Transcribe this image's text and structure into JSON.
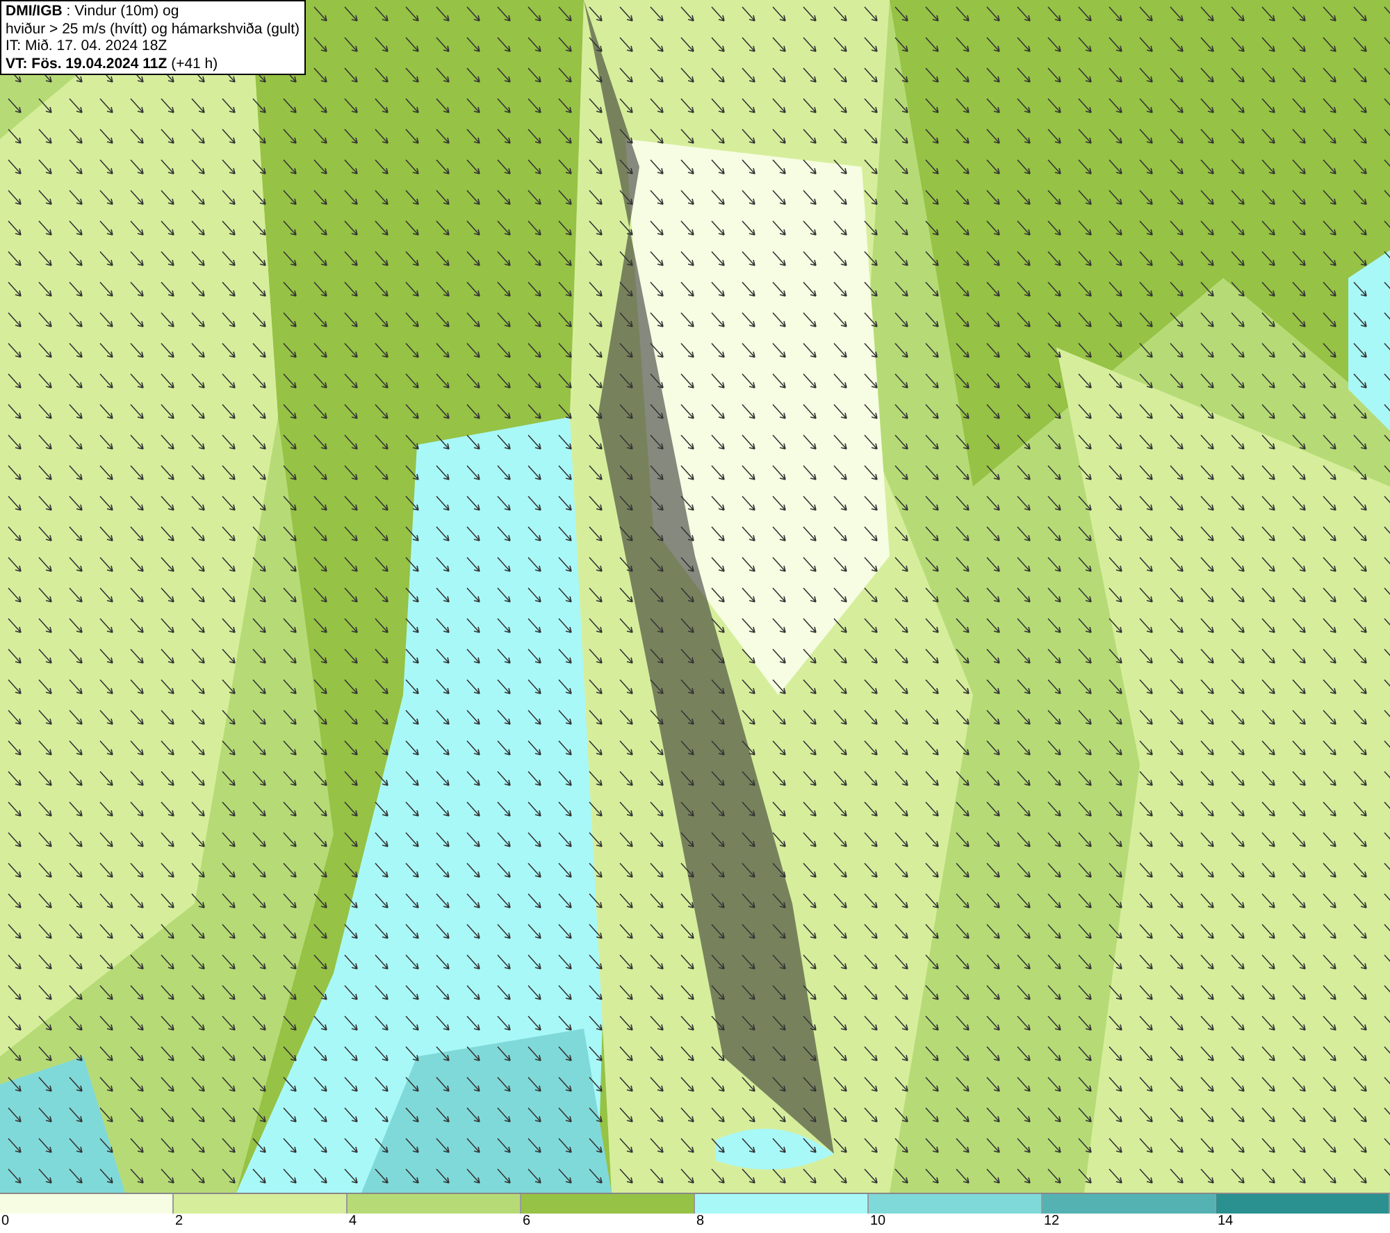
{
  "title_box": {
    "lines": [
      "**DMI/IGB** : Vindur (10m) og",
      "hviður > 25 m/s (hvítt) og hámarkshviða (gult)",
      "IT: Mið. 17. 04. 2024 18Z",
      "**VT: Fös. 19.04.2024 11Z** (+41 h)"
    ]
  },
  "legend": {
    "bins": [
      {
        "color": "#f6fde2"
      },
      {
        "color": "#d6ee9c"
      },
      {
        "color": "#b6db76"
      },
      {
        "color": "#96c245"
      },
      {
        "color": "#a9f8f8"
      },
      {
        "color": "#80d9d9"
      },
      {
        "color": "#55b2b2"
      },
      {
        "color": "#2a9090"
      }
    ],
    "ticks": [
      "0",
      "2",
      "4",
      "6",
      "8",
      "10",
      "12",
      "14"
    ]
  }
}
